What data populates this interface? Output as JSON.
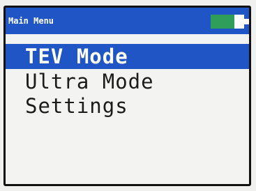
{
  "header": {
    "title": "Main Menu",
    "battery_level": 0.7,
    "battery_color": "#2f9e5a"
  },
  "menu": {
    "items": [
      {
        "label": "TEV Mode",
        "selected": true
      },
      {
        "label": "Ultra Mode",
        "selected": false
      },
      {
        "label": "Settings",
        "selected": false
      }
    ]
  },
  "colors": {
    "accent": "#1f55c4",
    "text": "#1b1b1b",
    "background": "#f3f3f1"
  }
}
